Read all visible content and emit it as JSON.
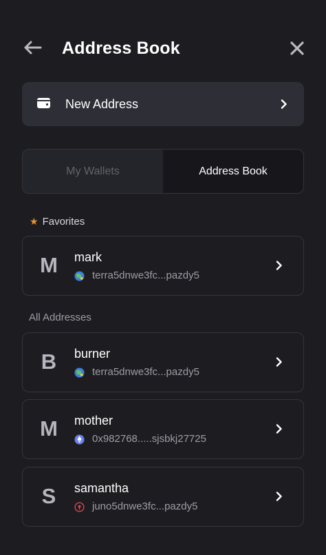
{
  "header": {
    "title": "Address Book",
    "back_icon": "arrow-left-icon",
    "close_icon": "close-icon"
  },
  "new_address": {
    "label": "New Address",
    "icon": "wallet-icon"
  },
  "tabs": [
    {
      "label": "My Wallets",
      "active": false
    },
    {
      "label": "Address Book",
      "active": true
    }
  ],
  "favorites": {
    "label": "Favorites",
    "icon": "star-icon",
    "items": [
      {
        "initial": "M",
        "name": "mark",
        "address": "terra5dnwe3fc...pazdy5",
        "chain_icon": "terra-icon"
      }
    ]
  },
  "all_addresses": {
    "label": "All Addresses",
    "items": [
      {
        "initial": "B",
        "name": "burner",
        "address": "terra5dnwe3fc...pazdy5",
        "chain_icon": "terra-icon"
      },
      {
        "initial": "M",
        "name": "mother",
        "address": "0x982768.....sjsbkj27725",
        "chain_icon": "ethereum-icon"
      },
      {
        "initial": "S",
        "name": "samantha",
        "address": "juno5dnwe3fc...pazdy5",
        "chain_icon": "juno-icon"
      }
    ]
  },
  "colors": {
    "background": "#1d1d21",
    "card_border": "#34353b",
    "button_bg": "#2e2f36",
    "accent_star": "#f0932b",
    "muted_text": "#9c9da5"
  }
}
